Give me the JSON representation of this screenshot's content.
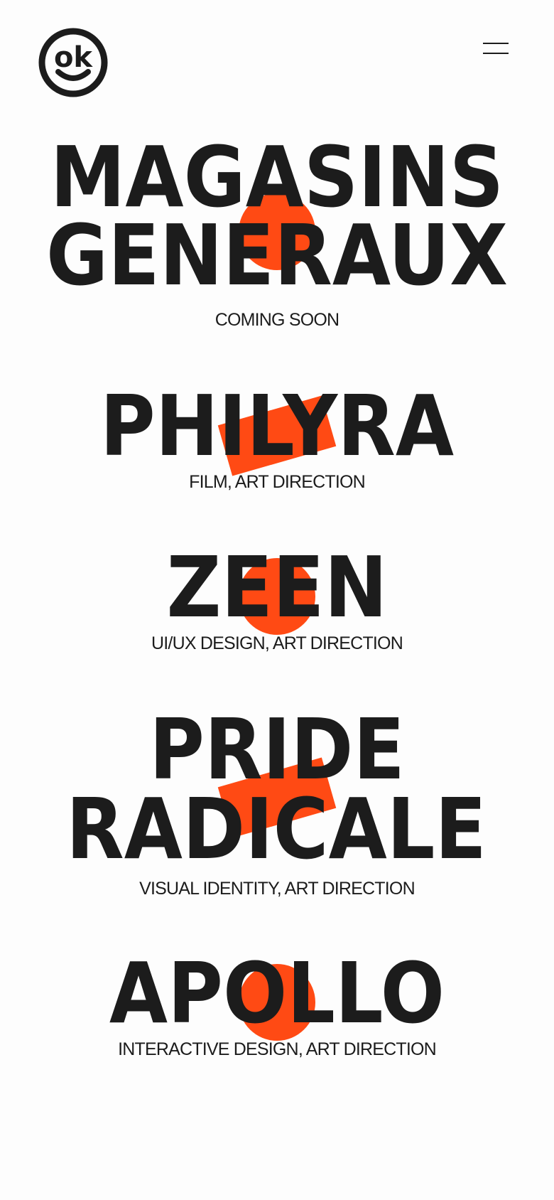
{
  "header": {
    "logo_text": "ok",
    "logo_icon": "smiley-ok-logo",
    "menu_icon": "hamburger-menu-icon"
  },
  "colors": {
    "accent": "#ff4a14",
    "text": "#1c1c1c",
    "background": "#fdfdfd"
  },
  "projects": [
    {
      "title_lines": [
        "MAGASINS",
        "GENERAUX"
      ],
      "subtitle": "COMING SOON",
      "shape": "circle"
    },
    {
      "title_lines": [
        "PHILYRA"
      ],
      "subtitle": "FILM, ART DIRECTION",
      "shape": "rectangle"
    },
    {
      "title_lines": [
        "ZEEN"
      ],
      "subtitle": "UI/UX DESIGN, ART DIRECTION",
      "shape": "circle"
    },
    {
      "title_lines": [
        "PRIDE",
        "RADICALE"
      ],
      "subtitle": "VISUAL IDENTITY, ART DIRECTION",
      "shape": "rectangle"
    },
    {
      "title_lines": [
        "APOLLO"
      ],
      "subtitle": "INTERACTIVE DESIGN, ART DIRECTION",
      "shape": "circle"
    }
  ]
}
